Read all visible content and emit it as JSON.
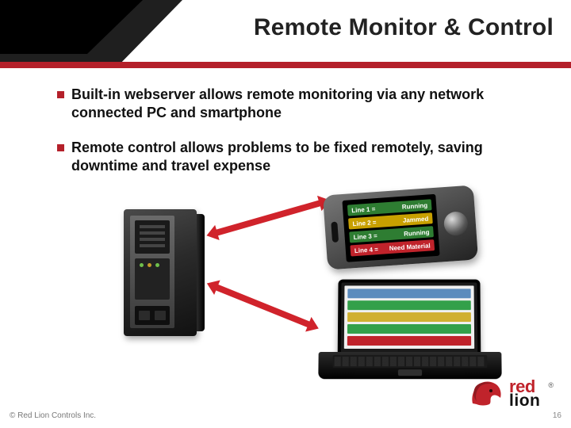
{
  "title": "Remote Monitor & Control",
  "bullets": [
    "Built-in webserver allows remote monitoring via any network connected PC and smartphone",
    "Remote control allows problems to be fixed remotely, saving downtime and travel expense"
  ],
  "phone_lines": [
    {
      "label": "Line 1 =",
      "status": "Running"
    },
    {
      "label": "Line 2 =",
      "status": "Jammed"
    },
    {
      "label": "Line 3 =",
      "status": "Running"
    },
    {
      "label": "Line 4 =",
      "status": "Need Material"
    }
  ],
  "logo": {
    "word1": "red",
    "word2": "lion",
    "reg": "®"
  },
  "copyright": "© Red Lion Controls Inc.",
  "page_number": "16",
  "colors": {
    "accent": "#b4202a"
  }
}
